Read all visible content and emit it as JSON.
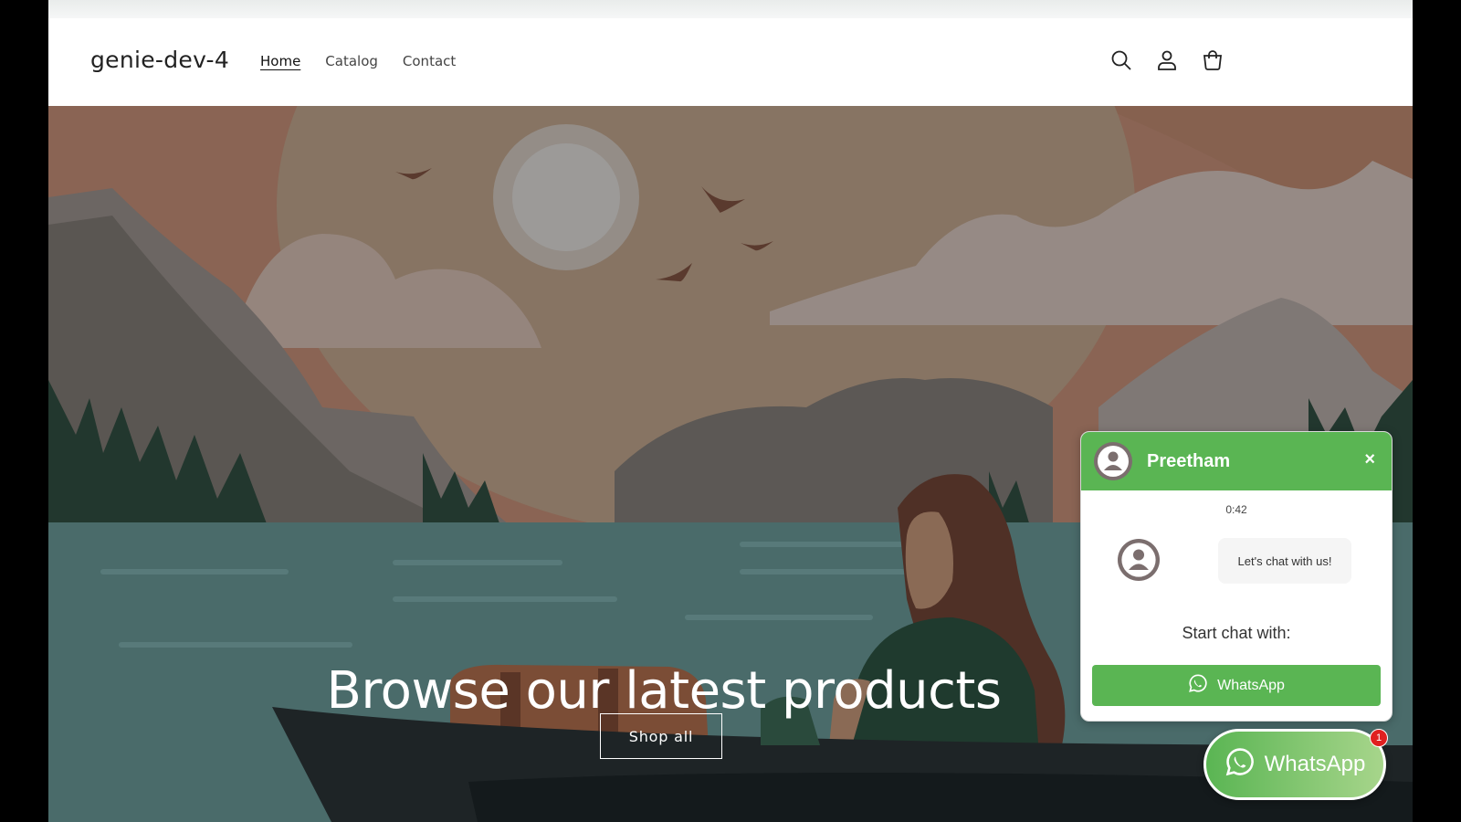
{
  "store": {
    "name": "genie-dev-4"
  },
  "nav": {
    "items": [
      {
        "label": "Home"
      },
      {
        "label": "Catalog"
      },
      {
        "label": "Contact"
      }
    ]
  },
  "header_icons": [
    "search-icon",
    "account-icon",
    "cart-icon"
  ],
  "hero": {
    "title": "Browse our latest products",
    "button_label": "Shop all"
  },
  "chat": {
    "agent_name": "Preetham",
    "close_symbol": "×",
    "time": "0:42",
    "message": "Let's chat with us!",
    "start_label": "Start chat with:",
    "button_label": "WhatsApp",
    "accent_color": "#5ab553"
  },
  "fab": {
    "label": "WhatsApp",
    "badge": "1"
  }
}
